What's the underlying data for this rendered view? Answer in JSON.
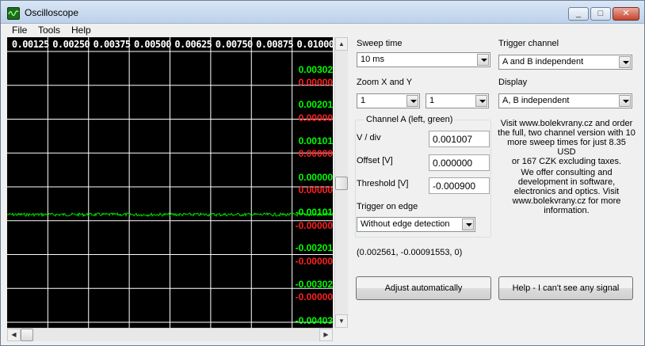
{
  "window": {
    "title": "Oscilloscope",
    "minimize": "_",
    "maximize": "□",
    "close": "✕"
  },
  "menu": [
    "File",
    "Tools",
    "Help"
  ],
  "scope": {
    "x_labels": [
      "0.00125",
      "0.00250",
      "0.00375",
      "0.00500",
      "0.00625",
      "0.00750",
      "0.00875",
      "0.01000"
    ],
    "y_labels": [
      {
        "text": "0.00302",
        "color": "green"
      },
      {
        "text": "0.00000",
        "color": "red"
      },
      {
        "text": "0.00201",
        "color": "green"
      },
      {
        "text": "0.00000",
        "color": "red"
      },
      {
        "text": "0.00101",
        "color": "green"
      },
      {
        "text": "0.00000",
        "color": "red"
      },
      {
        "text": "0.00000",
        "color": "green"
      },
      {
        "text": "0.00000",
        "color": "red"
      },
      {
        "text": "-0.00101",
        "color": "green"
      },
      {
        "text": "-0.00000",
        "color": "red"
      },
      {
        "text": "-0.00201",
        "color": "green"
      },
      {
        "text": "-0.00000",
        "color": "red"
      },
      {
        "text": "-0.00302",
        "color": "green"
      },
      {
        "text": "-0.00000",
        "color": "red"
      },
      {
        "text": "-0.00403",
        "color": "green"
      }
    ],
    "trace_color": "#00e000",
    "grid_color": "#ffffff"
  },
  "controls": {
    "sweep_time_label": "Sweep time",
    "sweep_time_value": "10 ms",
    "zoom_label": "Zoom X and Y",
    "zoom_x_value": "1",
    "zoom_y_value": "1",
    "channel_group_title": "Channel A (left, green)",
    "vdiv_label": "V / div",
    "vdiv_value": "0.001007",
    "offset_label": "Offset [V]",
    "offset_value": "0.000000",
    "threshold_label": "Threshold [V]",
    "threshold_value": "-0.000900",
    "trigger_edge_label": "Trigger on edge",
    "trigger_edge_value": "Without edge detection",
    "trigger_channel_label": "Trigger channel",
    "trigger_channel_value": "A and B independent",
    "display_label": "Display",
    "display_value": "A, B independent",
    "coords": "(0.002561, -0.00091553, 0)",
    "adjust_button": "Adjust automatically",
    "help_button": "Help - I can't see any signal"
  },
  "info": {
    "promo_lines": [
      "Visit www.bolekvrany.cz and order",
      "the full, two channel version with 10",
      "more sweep times for just 8.35 USD",
      "or 167 CZK excluding taxes."
    ],
    "consult_lines": [
      "We offer consulting and",
      "development in software,",
      "electronics and optics. Visit",
      "www.bolekvrany.cz for more",
      "information."
    ]
  }
}
